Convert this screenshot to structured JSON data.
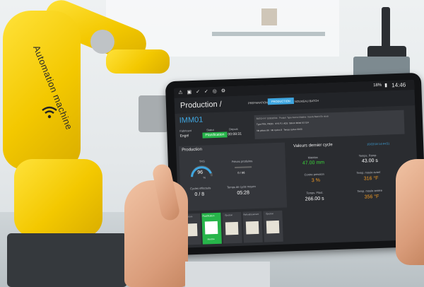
{
  "robot": {
    "label": "Automation machine",
    "label_icon": "wifi-icon"
  },
  "tablet": {
    "status": {
      "time": "14:46",
      "battery": "18%"
    },
    "nav": {
      "title": "Production /",
      "tabs": [
        {
          "label": "PREPARATION",
          "active": false
        },
        {
          "label": "PRODUCTION",
          "active": true
        },
        {
          "label": "NOUVEAU BATCH",
          "active": false
        }
      ]
    },
    "machine": {
      "name": "IMM01",
      "fabricant_label": "Fabricant",
      "fabricant": "Engel",
      "statut_label": "Statut",
      "statut": "Planification",
      "depuis_label": "Depuis",
      "depuis": "00:08:31"
    },
    "batch": {
      "rows": [
        [
          "BATCH N°",
          "103011534",
          "Produit",
          "Type Norme Matière",
          "Inserts",
          "Batch",
          "En stock"
        ],
        [
          "Type",
          "PRK. PRDD.",
          "SYS PJ",
          "ADS",
          "Silicon",
          "Métal",
          "6.5",
          "104"
        ],
        [
          "Nb pièces",
          "96",
          "Nb cycles",
          "8",
          "Temps cycles",
          "00:00"
        ]
      ]
    },
    "production": {
      "title": "Production",
      "trs_label": "TRS",
      "trs_value": "96",
      "trs_unit": "%",
      "cycles_label": "Cycles effectués",
      "cycles_value": "0 / 8",
      "pieces_label": "Pièces produites",
      "pieces_value": "0 / 96",
      "temps_label": "Temps de cycle moyen",
      "temps_value": "05:28"
    },
    "cycle": {
      "title": "Valeurs dernier cycle",
      "date": "10/22/18 14:44:51",
      "items": [
        {
          "label": "Matelas",
          "value": "47.00 mm",
          "color": "green"
        },
        {
          "label": "Temps. Ramp.",
          "value": "43.00 s",
          "color": "white"
        },
        {
          "label": "Contre pression",
          "value": "3 %",
          "color": "orange"
        },
        {
          "label": "Temp. moule avant",
          "value": "316 °F",
          "color": "orange"
        },
        {
          "label": "Temps. Plast.",
          "value": "266.00 s",
          "color": "white"
        },
        {
          "label": "Temp. moule arrière",
          "value": "356 °F",
          "color": "orange"
        }
      ]
    },
    "steps": [
      {
        "label": "Fermeture",
        "icon": "mold-close-icon",
        "active": false
      },
      {
        "label": "Plastification",
        "icon": "plastification-icon",
        "active": true,
        "sub": "Marche"
      },
      {
        "label": "Éjection",
        "icon": "ejection-icon",
        "active": false
      },
      {
        "label": "Refroidissement",
        "icon": "cooling-icon",
        "active": false
      },
      {
        "label": "Éjection",
        "icon": "ejection-icon",
        "active": false
      }
    ]
  },
  "colors": {
    "robot": "#f3c800",
    "accent": "#3fa6e0",
    "status_ok": "#27b54a",
    "warning": "#f39b24"
  }
}
